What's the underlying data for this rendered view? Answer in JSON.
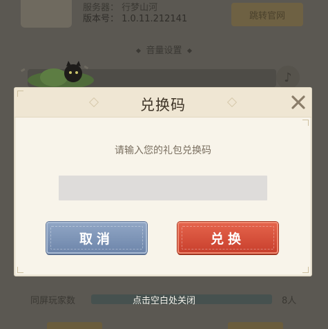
{
  "background": {
    "server_text": "服务器：  行梦山河",
    "version_text": "版本号：  1.0.11.212141",
    "gold_button_label": "跳转官网",
    "section_title": "音量设置",
    "players_label": "同屏玩家数",
    "players_count": "8人"
  },
  "dialog": {
    "title": "兑换码",
    "prompt": "请输入您的礼包兑换码",
    "input_value": "",
    "input_placeholder": "",
    "cancel_label": "取消",
    "redeem_label": "兑换",
    "close_icon": "close-x-icon"
  },
  "footer": {
    "tap_to_close": "点击空白处关闭"
  },
  "colors": {
    "cancel_button": "#7d93b8",
    "redeem_button": "#d44e37",
    "dialog_bg": "#f8f4ea",
    "overlay": "#5b5852"
  }
}
